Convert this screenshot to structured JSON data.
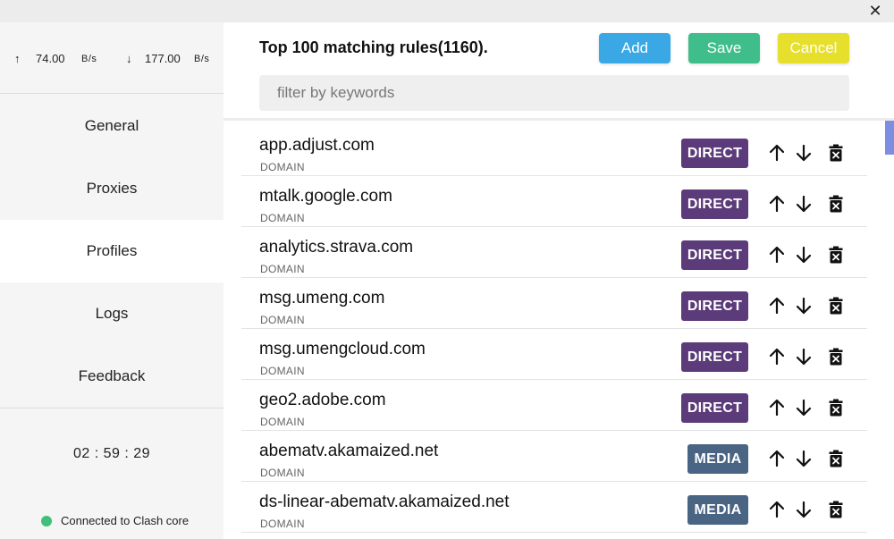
{
  "window": {
    "close_glyph": "✕"
  },
  "sidebar": {
    "traffic": {
      "up_arrow": "↑",
      "up_value": "74.00",
      "up_unit": "B/s",
      "down_arrow": "↓",
      "down_value": "177.00",
      "down_unit": "B/s"
    },
    "nav": [
      {
        "label": "General"
      },
      {
        "label": "Proxies"
      },
      {
        "label": "Profiles",
        "active": true
      },
      {
        "label": "Logs"
      },
      {
        "label": "Feedback"
      }
    ],
    "uptime": "02 : 59 : 29",
    "status_text": "Connected to Clash core",
    "status_color": "#3fbf79"
  },
  "header": {
    "title": "Top 100 matching rules(1160).",
    "add_label": "Add",
    "save_label": "Save",
    "cancel_label": "Cancel",
    "search_placeholder": "filter by keywords",
    "colors": {
      "add": "#3aa8e4",
      "save": "#3fbd8a",
      "cancel": "#e6df2c"
    }
  },
  "rules": [
    {
      "host": "app.adjust.com",
      "type": "DOMAIN",
      "policy": "DIRECT"
    },
    {
      "host": "mtalk.google.com",
      "type": "DOMAIN",
      "policy": "DIRECT"
    },
    {
      "host": "analytics.strava.com",
      "type": "DOMAIN",
      "policy": "DIRECT"
    },
    {
      "host": "msg.umeng.com",
      "type": "DOMAIN",
      "policy": "DIRECT"
    },
    {
      "host": "msg.umengcloud.com",
      "type": "DOMAIN",
      "policy": "DIRECT"
    },
    {
      "host": "geo2.adobe.com",
      "type": "DOMAIN",
      "policy": "DIRECT"
    },
    {
      "host": "abematv.akamaized.net",
      "type": "DOMAIN",
      "policy": "MEDIA"
    },
    {
      "host": "ds-linear-abematv.akamaized.net",
      "type": "DOMAIN",
      "policy": "MEDIA"
    }
  ],
  "policy_colors": {
    "DIRECT": "#5c3b7a",
    "MEDIA": "#4a6583"
  },
  "icons": {
    "up": "arrow-up-icon",
    "down": "arrow-down-icon",
    "delete": "trash-icon"
  }
}
